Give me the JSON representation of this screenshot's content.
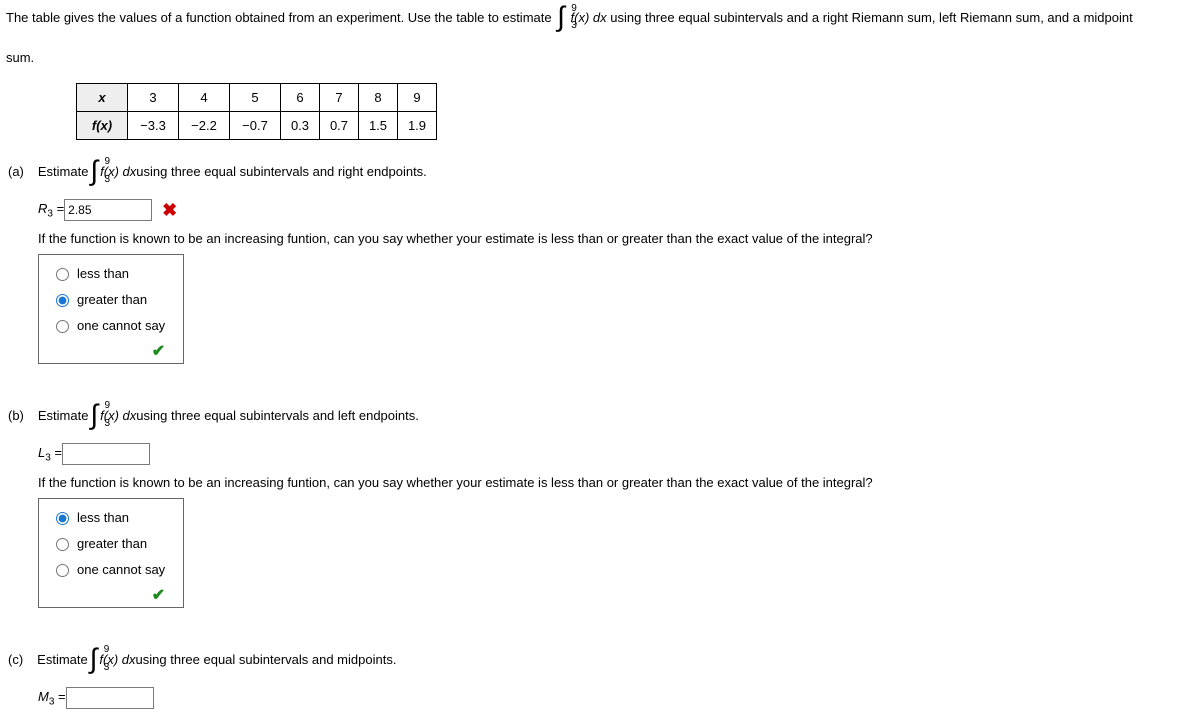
{
  "intro": {
    "pre": "The table gives the values of a function obtained from an experiment. Use the table to estimate ",
    "integral_lb": "3",
    "integral_ub": "9",
    "integral_body": "f(x) dx",
    "post": " using three equal subintervals and a right Riemann sum, left Riemann sum, and a midpoint",
    "tail": "sum."
  },
  "table": {
    "row1": [
      "x",
      "3",
      "4",
      "5",
      "6",
      "7",
      "8",
      "9"
    ],
    "row2": [
      "f(x)",
      "−3.3",
      "−2.2",
      "−0.7",
      "0.3",
      "0.7",
      "1.5",
      "1.9"
    ],
    "widths": [
      50,
      50,
      50,
      50,
      38,
      38,
      38,
      38
    ]
  },
  "parts": {
    "a": {
      "label": "(a)",
      "estimate": "Estimate ",
      "int_lb": "3",
      "int_ub": "9",
      "int_body": "f(x) dx",
      "after": " using three equal subintervals and right endpoints.",
      "ansvar": "R",
      "ansval": "2.85",
      "question": "If the function is known to be an increasing funtion, can you say whether your estimate is less than or greater than the exact value of the integral?",
      "options": [
        "less than",
        "greater than",
        "one cannot say"
      ],
      "selected": 1
    },
    "b": {
      "label": "(b)",
      "estimate": "Estimate ",
      "int_lb": "3",
      "int_ub": "9",
      "int_body": "f(x) dx",
      "after": " using three equal subintervals and left endpoints.",
      "ansvar": "L",
      "ansval": "",
      "question": "If the function is known to be an increasing funtion, can you say whether your estimate is less than or greater than the exact value of the integral?",
      "options": [
        "less than",
        "greater than",
        "one cannot say"
      ],
      "selected": 0
    },
    "c": {
      "label": "(c)",
      "estimate": "Estimate ",
      "int_lb": "3",
      "int_ub": "9",
      "int_body": "f(x) dx",
      "after": " using three equal subintervals and midpoints.",
      "ansvar": "M",
      "ansval": ""
    }
  },
  "chart_data": {
    "type": "table",
    "x": [
      3,
      4,
      5,
      6,
      7,
      8,
      9
    ],
    "fx": [
      -3.3,
      -2.2,
      -0.7,
      0.3,
      0.7,
      1.5,
      1.9
    ]
  }
}
